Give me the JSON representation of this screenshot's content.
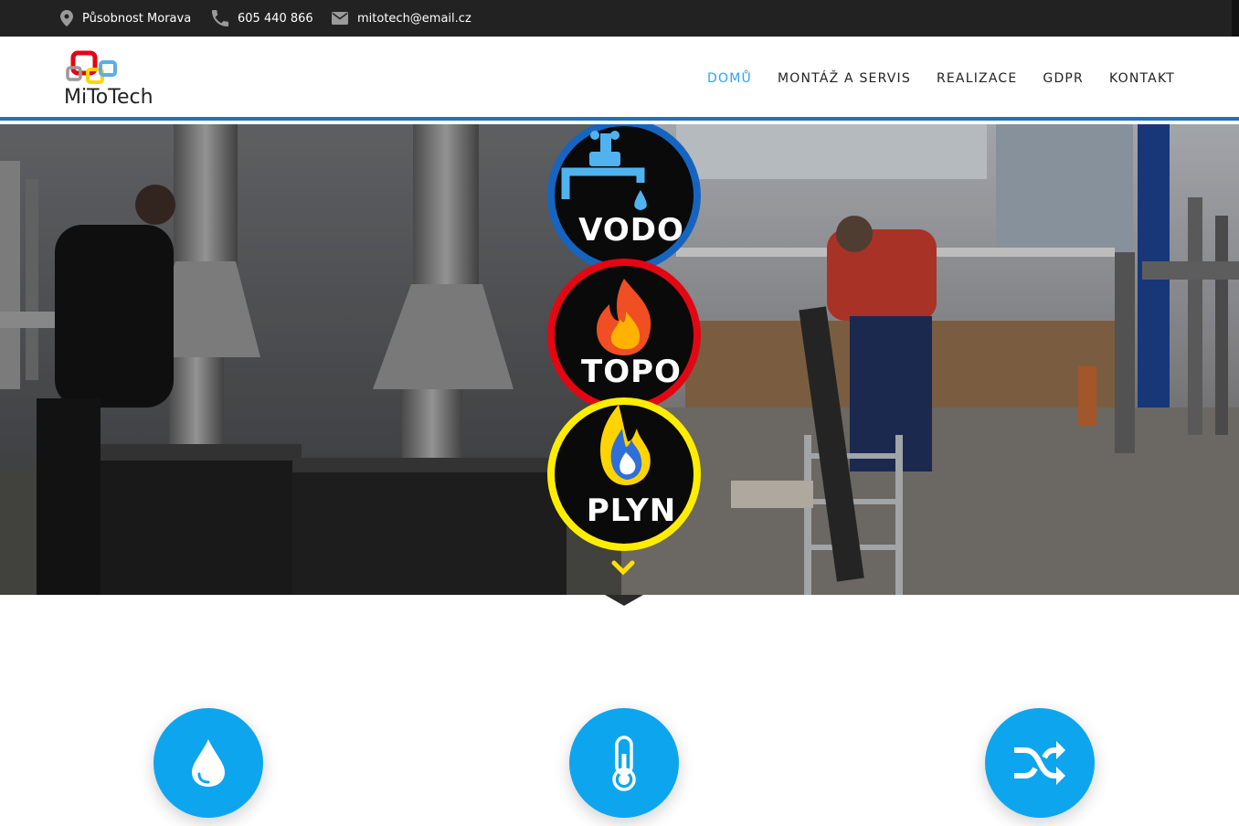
{
  "topbar": {
    "location": "Působnost Morava",
    "phone": "605 440 866",
    "email": "mitotech@email.cz"
  },
  "logo": {
    "text": "MiToTech"
  },
  "nav": {
    "items": [
      {
        "label": "DOMŮ",
        "active": true
      },
      {
        "label": "MONTÁŽ A SERVIS",
        "active": false
      },
      {
        "label": "REALIZACE",
        "active": false
      },
      {
        "label": "GDPR",
        "active": false
      },
      {
        "label": "KONTAKT",
        "active": false
      }
    ]
  },
  "hero": {
    "badges": [
      {
        "label": "VODO",
        "ring_color": "#1565c0",
        "icon": "faucet-drop-icon"
      },
      {
        "label": "TOPO",
        "ring_color": "#e30613",
        "icon": "fire-icon"
      },
      {
        "label": "PLYN",
        "ring_color": "#ffed00",
        "icon": "gas-flame-icon"
      }
    ]
  },
  "features": [
    {
      "icon": "water-drop-icon"
    },
    {
      "icon": "thermometer-icon"
    },
    {
      "icon": "shuffle-icon"
    }
  ],
  "colors": {
    "accent": "#2ea3f2",
    "header_border": "#1e73be",
    "feature_circle": "#0ea5ef",
    "topbar": "#222222"
  }
}
